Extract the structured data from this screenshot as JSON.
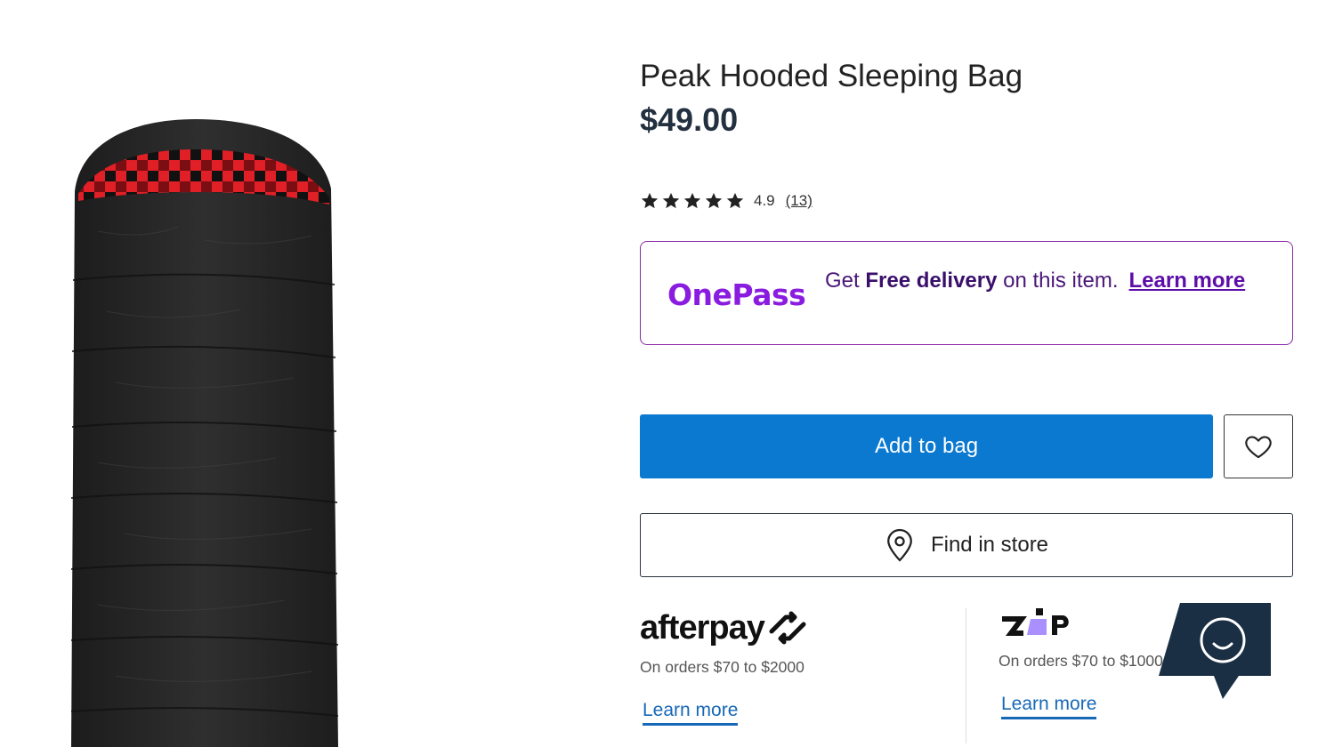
{
  "product": {
    "title": "Peak Hooded Sleeping Bag",
    "price": "$49.00",
    "rating": {
      "stars": 5,
      "value": "4.9",
      "count": "(13)"
    }
  },
  "onepass": {
    "logo": "OnePass",
    "text_pre": "Get ",
    "text_bold": "Free delivery",
    "text_post": " on this item.",
    "learn_more": "Learn more",
    "brand_color": "#8a1ce0"
  },
  "actions": {
    "add_to_bag": "Add to bag",
    "add_to_bag_color": "#0b79d0",
    "find_in_store": "Find in store"
  },
  "payments": {
    "afterpay": {
      "logo": "afterpay",
      "subtitle": "On orders $70 to $2000",
      "learn_more": "Learn more"
    },
    "zip": {
      "logo": "zip",
      "subtitle": "On orders $70 to $1000",
      "learn_more": "Learn more"
    }
  },
  "icons": [
    "star-icon",
    "heart-icon",
    "location-pin-icon",
    "chat-icon"
  ]
}
